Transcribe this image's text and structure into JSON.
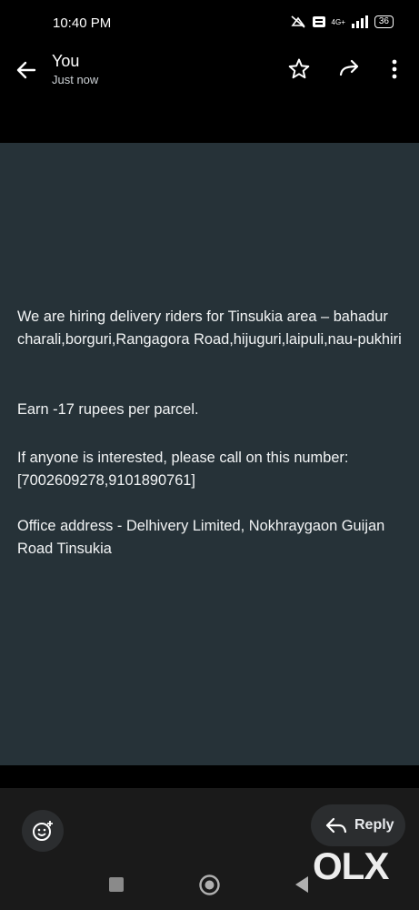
{
  "status_bar": {
    "time": "10:40 PM",
    "network": "4G+",
    "vo_label": "VoLTE",
    "battery": "36",
    "icons": [
      "do-not-disturb-icon",
      "volte-icon",
      "signal-icon",
      "battery-icon"
    ]
  },
  "app_bar": {
    "title": "You",
    "subtitle": "Just now",
    "icons": [
      "back-arrow-icon",
      "star-icon",
      "forward-icon",
      "more-vert-icon"
    ]
  },
  "message": {
    "paragraphs": [
      "We are hiring delivery riders for Tinsukia area – bahadur charali,borguri,Rangagora Road,hijuguri,laipuli,nau-pukhiri",
      "Earn -17 rupees per parcel.",
      "If anyone is interested, please call on this number: [7002609278,9101890761]",
      "Office address - Delhivery Limited, Nokhraygaon Guijan Road Tinsukia"
    ]
  },
  "actions": {
    "reply_label": "Reply",
    "emoji_icon": "add-reaction-icon",
    "reply_icon": "reply-icon"
  },
  "watermark": {
    "text": "OLX"
  },
  "nav_bar": {
    "icons": [
      "recents-square-icon",
      "home-circle-icon",
      "back-triangle-icon"
    ]
  },
  "colors": {
    "card_background": "#263238",
    "page_background": "#000000",
    "bottom_bar": "#1a1a1a"
  }
}
